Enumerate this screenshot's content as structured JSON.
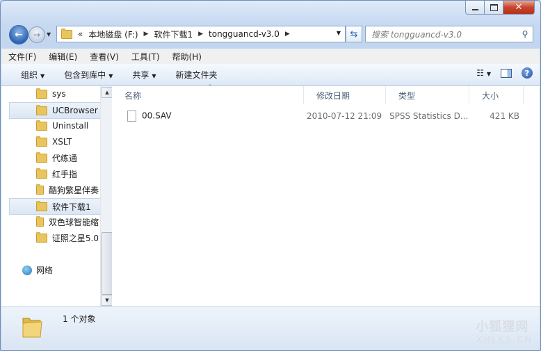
{
  "address": {
    "segments": [
      "本地磁盘 (F:)",
      "软件下载1",
      "tongguancd-v3.0"
    ],
    "overflow": "«"
  },
  "search": {
    "placeholder": "搜索 tongguancd-v3.0"
  },
  "menu": [
    "文件(F)",
    "编辑(E)",
    "查看(V)",
    "工具(T)",
    "帮助(H)"
  ],
  "commands": {
    "organize": "组织",
    "include_library": "包含到库中",
    "share": "共享",
    "new_folder": "新建文件夹"
  },
  "nav_tree": {
    "items": [
      "sys",
      "UCBrowser",
      "Uninstall",
      "XSLT",
      "代练通",
      "红手指",
      "酷狗繁星伴奏",
      "软件下载1",
      "双色球智能缩",
      "证照之星5.0"
    ],
    "highlighted": [
      "UCBrowser",
      "软件下载1"
    ],
    "network": "网络"
  },
  "columns": [
    "名称",
    "修改日期",
    "类型",
    "大小"
  ],
  "files": [
    {
      "name": "00.SAV",
      "modified": "2010-07-12 21:09",
      "type": "SPSS Statistics D...",
      "size": "421 KB"
    }
  ],
  "details": {
    "count": "1 个对象"
  },
  "watermark": {
    "cn": "小狐狸网",
    "en": "XHLKS.CN"
  },
  "icons": {
    "back": "arrow-left-icon",
    "forward": "arrow-right-icon",
    "refresh": "refresh-icon",
    "search": "magnifier-icon",
    "views": "list-view-icon",
    "preview": "preview-pane-icon",
    "help": "help-icon",
    "folder": "folder-icon",
    "network": "network-icon",
    "file": "file-icon"
  }
}
